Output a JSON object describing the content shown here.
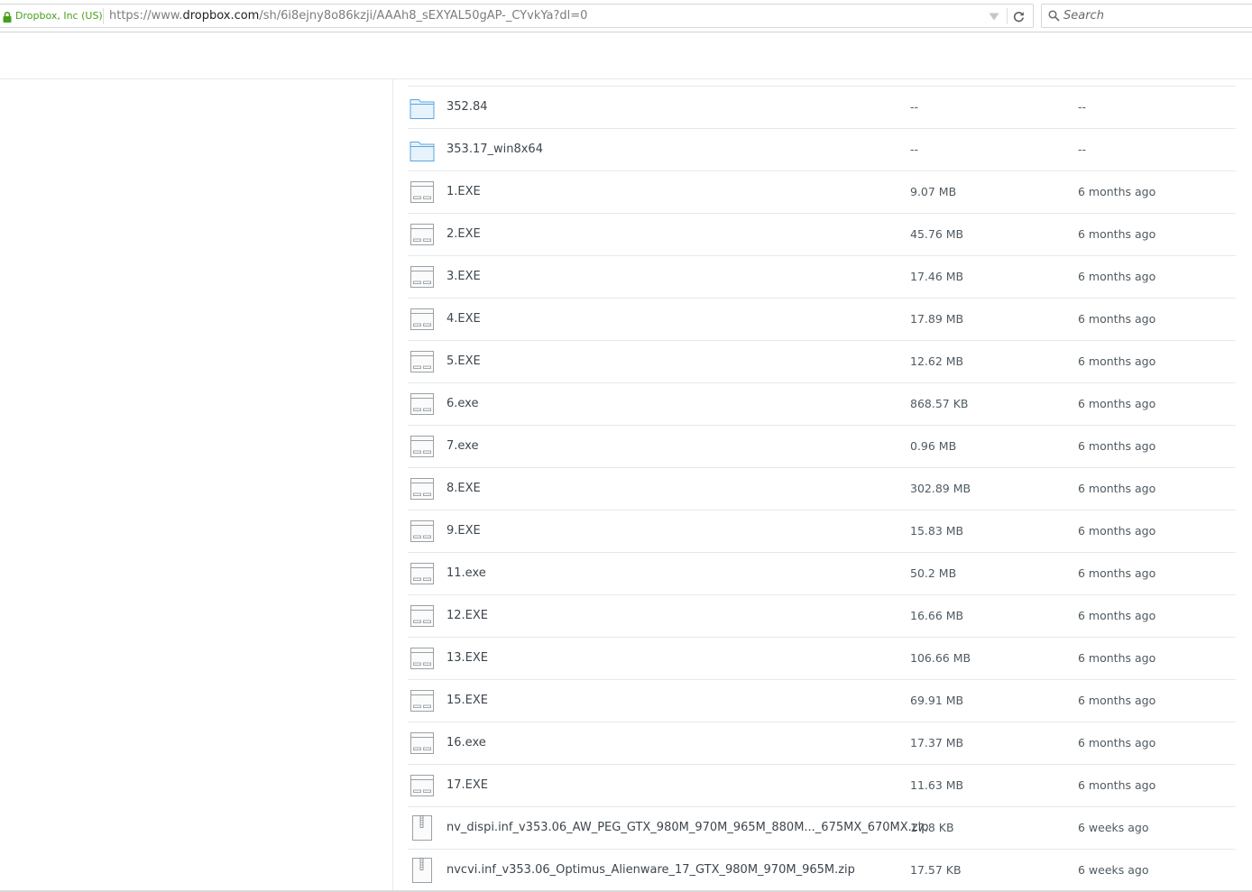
{
  "browser": {
    "site_identity": "Dropbox, Inc (US)",
    "url_prefix": "https://www.",
    "url_domain": "dropbox.com",
    "url_path": "/sh/6i8ejny8o86kzji/AAAh8_sEXYAL50gAP-_CYvkYa?dl=0",
    "search_placeholder": "Search",
    "accent_color": "#4a9e1e"
  },
  "files": [
    {
      "name": "352.84",
      "size": "--",
      "modified": "--",
      "icon": "folder-icon"
    },
    {
      "name": "353.17_win8x64",
      "size": "--",
      "modified": "--",
      "icon": "folder-icon"
    },
    {
      "name": "1.EXE",
      "size": "9.07 MB",
      "modified": "6 months ago",
      "icon": "exe-file-icon"
    },
    {
      "name": "2.EXE",
      "size": "45.76 MB",
      "modified": "6 months ago",
      "icon": "exe-file-icon"
    },
    {
      "name": "3.EXE",
      "size": "17.46 MB",
      "modified": "6 months ago",
      "icon": "exe-file-icon"
    },
    {
      "name": "4.EXE",
      "size": "17.89 MB",
      "modified": "6 months ago",
      "icon": "exe-file-icon"
    },
    {
      "name": "5.EXE",
      "size": "12.62 MB",
      "modified": "6 months ago",
      "icon": "exe-file-icon"
    },
    {
      "name": "6.exe",
      "size": "868.57 KB",
      "modified": "6 months ago",
      "icon": "exe-file-icon"
    },
    {
      "name": "7.exe",
      "size": "0.96 MB",
      "modified": "6 months ago",
      "icon": "exe-file-icon"
    },
    {
      "name": "8.EXE",
      "size": "302.89 MB",
      "modified": "6 months ago",
      "icon": "exe-file-icon"
    },
    {
      "name": "9.EXE",
      "size": "15.83 MB",
      "modified": "6 months ago",
      "icon": "exe-file-icon"
    },
    {
      "name": "11.exe",
      "size": "50.2 MB",
      "modified": "6 months ago",
      "icon": "exe-file-icon"
    },
    {
      "name": "12.EXE",
      "size": "16.66 MB",
      "modified": "6 months ago",
      "icon": "exe-file-icon"
    },
    {
      "name": "13.EXE",
      "size": "106.66 MB",
      "modified": "6 months ago",
      "icon": "exe-file-icon"
    },
    {
      "name": "15.EXE",
      "size": "69.91 MB",
      "modified": "6 months ago",
      "icon": "exe-file-icon"
    },
    {
      "name": "16.exe",
      "size": "17.37 MB",
      "modified": "6 months ago",
      "icon": "exe-file-icon"
    },
    {
      "name": "17.EXE",
      "size": "11.63 MB",
      "modified": "6 months ago",
      "icon": "exe-file-icon"
    },
    {
      "name": "nv_dispi.inf_v353.06_AW_PEG_GTX_980M_970M_965M_880M..._675MX_670MX.zip",
      "size": "17.8 KB",
      "modified": "6 weeks ago",
      "icon": "zip-file-icon"
    },
    {
      "name": "nvcvi.inf_v353.06_Optimus_Alienware_17_GTX_980M_970M_965M.zip",
      "size": "17.57 KB",
      "modified": "6 weeks ago",
      "icon": "zip-file-icon"
    }
  ]
}
